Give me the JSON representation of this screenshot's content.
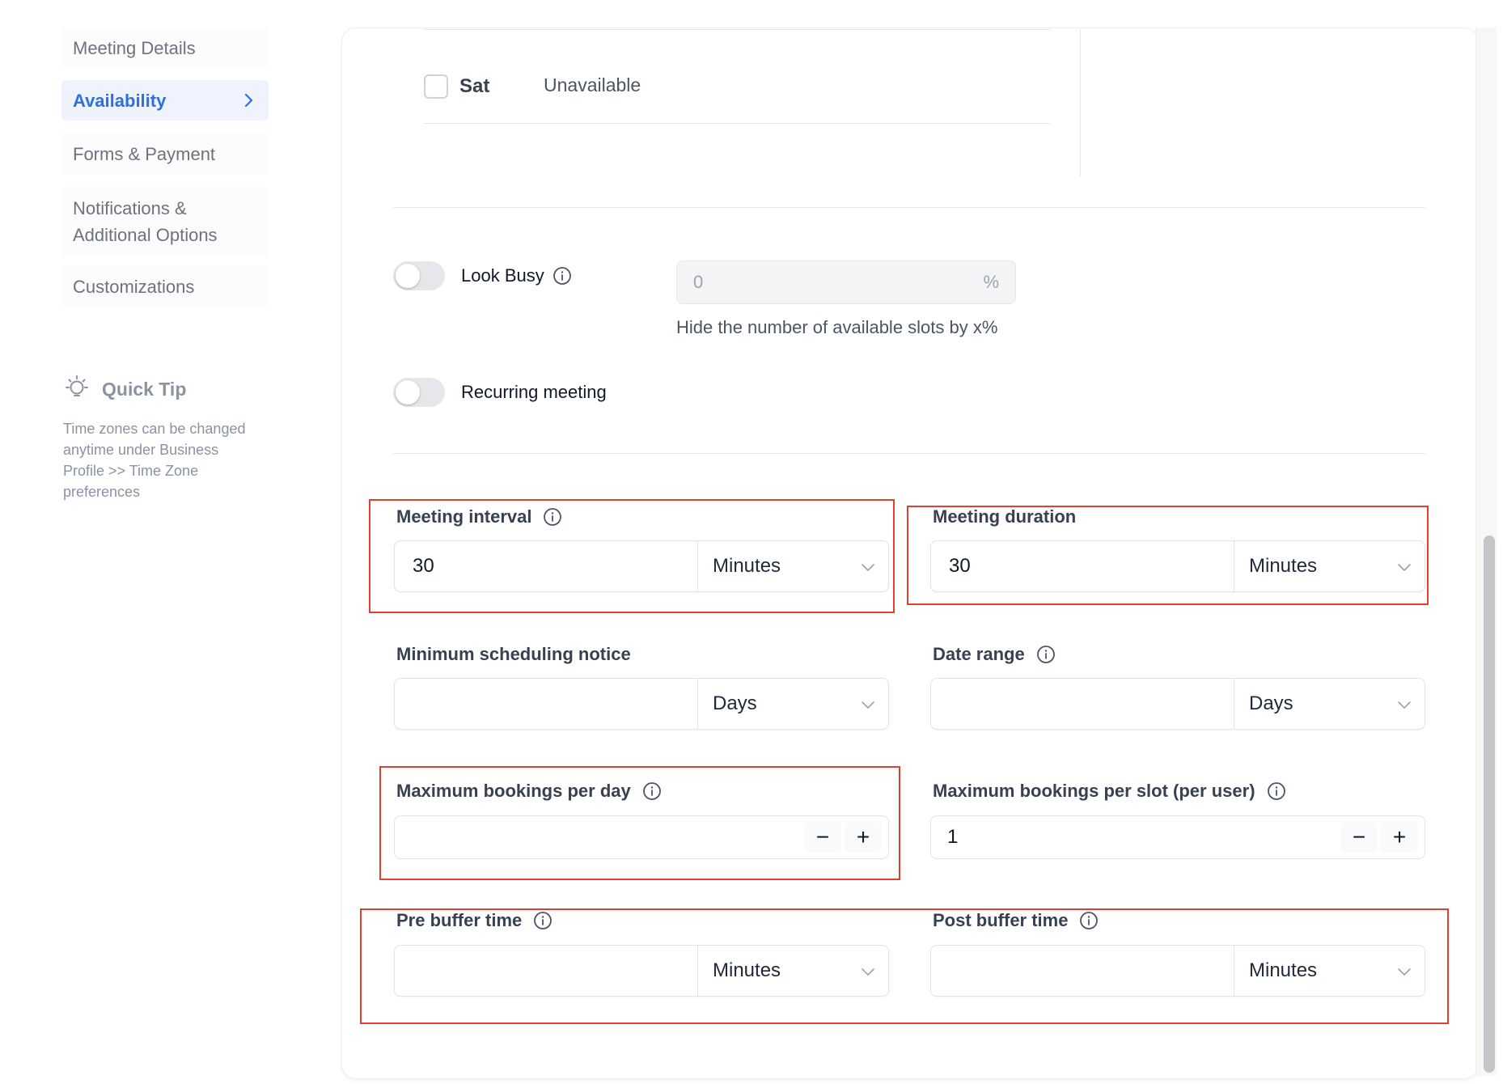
{
  "sidebar": {
    "items": [
      {
        "label": "Meeting Details"
      },
      {
        "label": "Availability"
      },
      {
        "label": "Forms & Payment"
      },
      {
        "label": "Notifications &",
        "label2": "Additional Options"
      },
      {
        "label": "Customizations"
      }
    ],
    "quick_tip": {
      "title": "Quick Tip",
      "body": "Time zones can be changed anytime under Business Profile >> Time Zone preferences"
    }
  },
  "schedule": {
    "day": "Sat",
    "status": "Unavailable"
  },
  "look_busy": {
    "label": "Look Busy",
    "value": "0",
    "suffix": "%",
    "help": "Hide the number of available slots by x%",
    "enabled": false
  },
  "recurring": {
    "label": "Recurring meeting",
    "enabled": false
  },
  "fields": {
    "meeting_interval": {
      "label": "Meeting interval",
      "value": "30",
      "unit": "Minutes"
    },
    "meeting_duration": {
      "label": "Meeting duration",
      "value": "30",
      "unit": "Minutes"
    },
    "min_notice": {
      "label": "Minimum scheduling notice",
      "value": "",
      "unit": "Days"
    },
    "date_range": {
      "label": "Date range",
      "value": "",
      "unit": "Days"
    },
    "max_per_day": {
      "label": "Maximum bookings per day",
      "value": ""
    },
    "max_per_slot": {
      "label": "Maximum bookings per slot (per user)",
      "value": "1"
    },
    "pre_buffer": {
      "label": "Pre buffer time",
      "value": "",
      "unit": "Minutes"
    },
    "post_buffer": {
      "label": "Post buffer time",
      "value": "",
      "unit": "Minutes"
    }
  },
  "stepper": {
    "minus": "−",
    "plus": "+"
  },
  "colors": {
    "accent": "#2f6fe0",
    "highlight_box": "#e0412f"
  }
}
